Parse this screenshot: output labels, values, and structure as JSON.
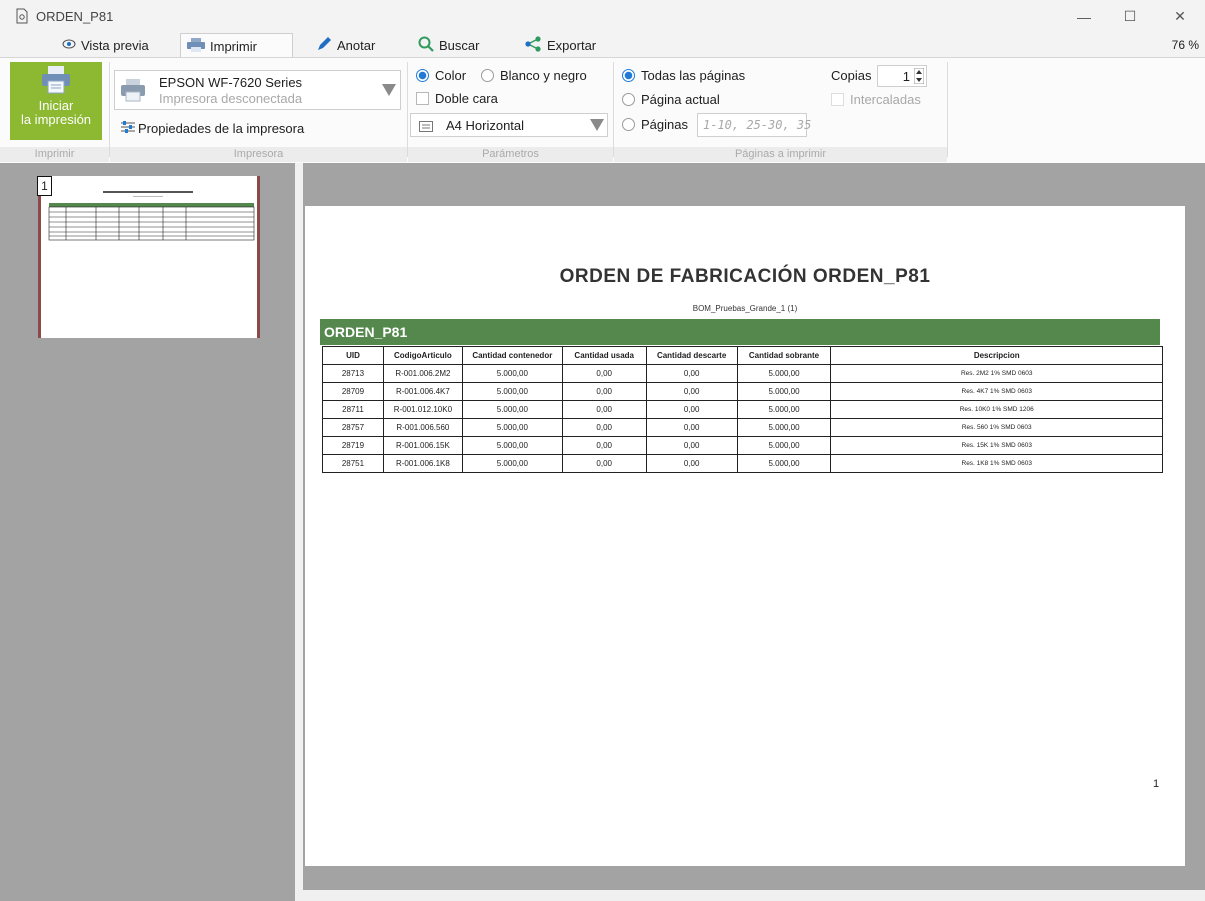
{
  "window": {
    "title": "ORDEN_P81",
    "controls": [
      "—",
      "☐",
      "✕"
    ]
  },
  "tabs": [
    {
      "label": "Vista previa",
      "icon": "eye-icon"
    },
    {
      "label": "Imprimir",
      "icon": "printer-icon"
    },
    {
      "label": "Anotar",
      "icon": "pen-icon"
    },
    {
      "label": "Buscar",
      "icon": "search-icon"
    },
    {
      "label": "Exportar",
      "icon": "share-icon"
    }
  ],
  "zoom": "76 %",
  "ribbon": {
    "print_button": {
      "line1": "Iniciar",
      "line2": "la impresión"
    },
    "printer": {
      "name": "EPSON WF-7620 Series",
      "status": "Impresora desconectada",
      "properties": "Propiedades de la impresora"
    },
    "params": {
      "color": "Color",
      "bw": "Blanco y negro",
      "duplex": "Doble cara",
      "paper": "A4 Horizontal"
    },
    "pages": {
      "all": "Todas las páginas",
      "current": "Página actual",
      "range_label": "Páginas",
      "range_placeholder": "1-10, 25-30, 35"
    },
    "copies": {
      "label": "Copias",
      "value": "1",
      "collate": "Intercaladas"
    },
    "groups": [
      "Imprimir",
      "Impresora",
      "Parámetros",
      "Páginas a imprimir"
    ]
  },
  "thumbnail": {
    "page_number": "1"
  },
  "report": {
    "title": "ORDEN DE FABRICACIÓN ORDEN_P81",
    "subtitle": "BOM_Pruebas_Grande_1 (1)",
    "section": "ORDEN_P81",
    "columns": [
      "UID",
      "CodigoArticulo",
      "Cantidad contenedor",
      "Cantidad usada",
      "Cantidad descarte",
      "Cantidad sobrante",
      "Descripcion"
    ],
    "rows": [
      [
        "28713",
        "R-001.006.2M2",
        "5.000,00",
        "0,00",
        "0,00",
        "5.000,00",
        "Res. 2M2 1% SMD 0603"
      ],
      [
        "28709",
        "R-001.006.4K7",
        "5.000,00",
        "0,00",
        "0,00",
        "5.000,00",
        "Res. 4K7 1% SMD 0603"
      ],
      [
        "28711",
        "R-001.012.10K0",
        "5.000,00",
        "0,00",
        "0,00",
        "5.000,00",
        "Res. 10K0 1% SMD 1206"
      ],
      [
        "28757",
        "R-001.006.560",
        "5.000,00",
        "0,00",
        "0,00",
        "5.000,00",
        "Res. 560 1% SMD 0603"
      ],
      [
        "28719",
        "R-001.006.15K",
        "5.000,00",
        "0,00",
        "0,00",
        "5.000,00",
        "Res. 15K 1% SMD 0603"
      ],
      [
        "28751",
        "R-001.006.1K8",
        "5.000,00",
        "0,00",
        "0,00",
        "5.000,00",
        "Res. 1K8 1% SMD 0603"
      ]
    ],
    "page_number": "1"
  },
  "colors": {
    "accent_green": "#8cb832",
    "table_header": "#55884d",
    "radio_blue": "#1f7bd6"
  }
}
